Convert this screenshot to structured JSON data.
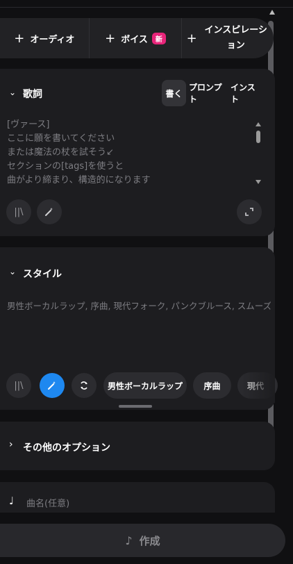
{
  "tabs": [
    {
      "icon": "plus-icon",
      "label": "オーディオ"
    },
    {
      "icon": "plus-icon",
      "label": "ボイス",
      "badge": "新"
    },
    {
      "icon": "plus-icon",
      "label": "インスピレーション"
    }
  ],
  "lyrics": {
    "title": "歌詞",
    "modes": [
      "書く",
      "プロンプト",
      "インスト"
    ],
    "active_mode": "書く",
    "placeholder_lines": [
      "[ヴァース]",
      "ここに願を書いてください",
      "または魔法の杖を試そう↙",
      "セクションの[tags]を使うと",
      "曲がより締まり、構造的になります"
    ]
  },
  "style": {
    "title": "スタイル",
    "placeholder": "男性ボーカルラップ, 序曲, 現代フォーク, パンクブルース, スムーズポップ",
    "chips": [
      "男性ボーカルラップ",
      "序曲",
      "現代"
    ]
  },
  "options": {
    "title": "その他のオプション"
  },
  "song_name": {
    "placeholder": "曲名(任意)"
  },
  "create": {
    "label": "作成"
  },
  "colors": {
    "accent_blue": "#1e88f0",
    "badge_pink": "#e8257a",
    "background": "#101012",
    "card": "#1d1d20"
  }
}
